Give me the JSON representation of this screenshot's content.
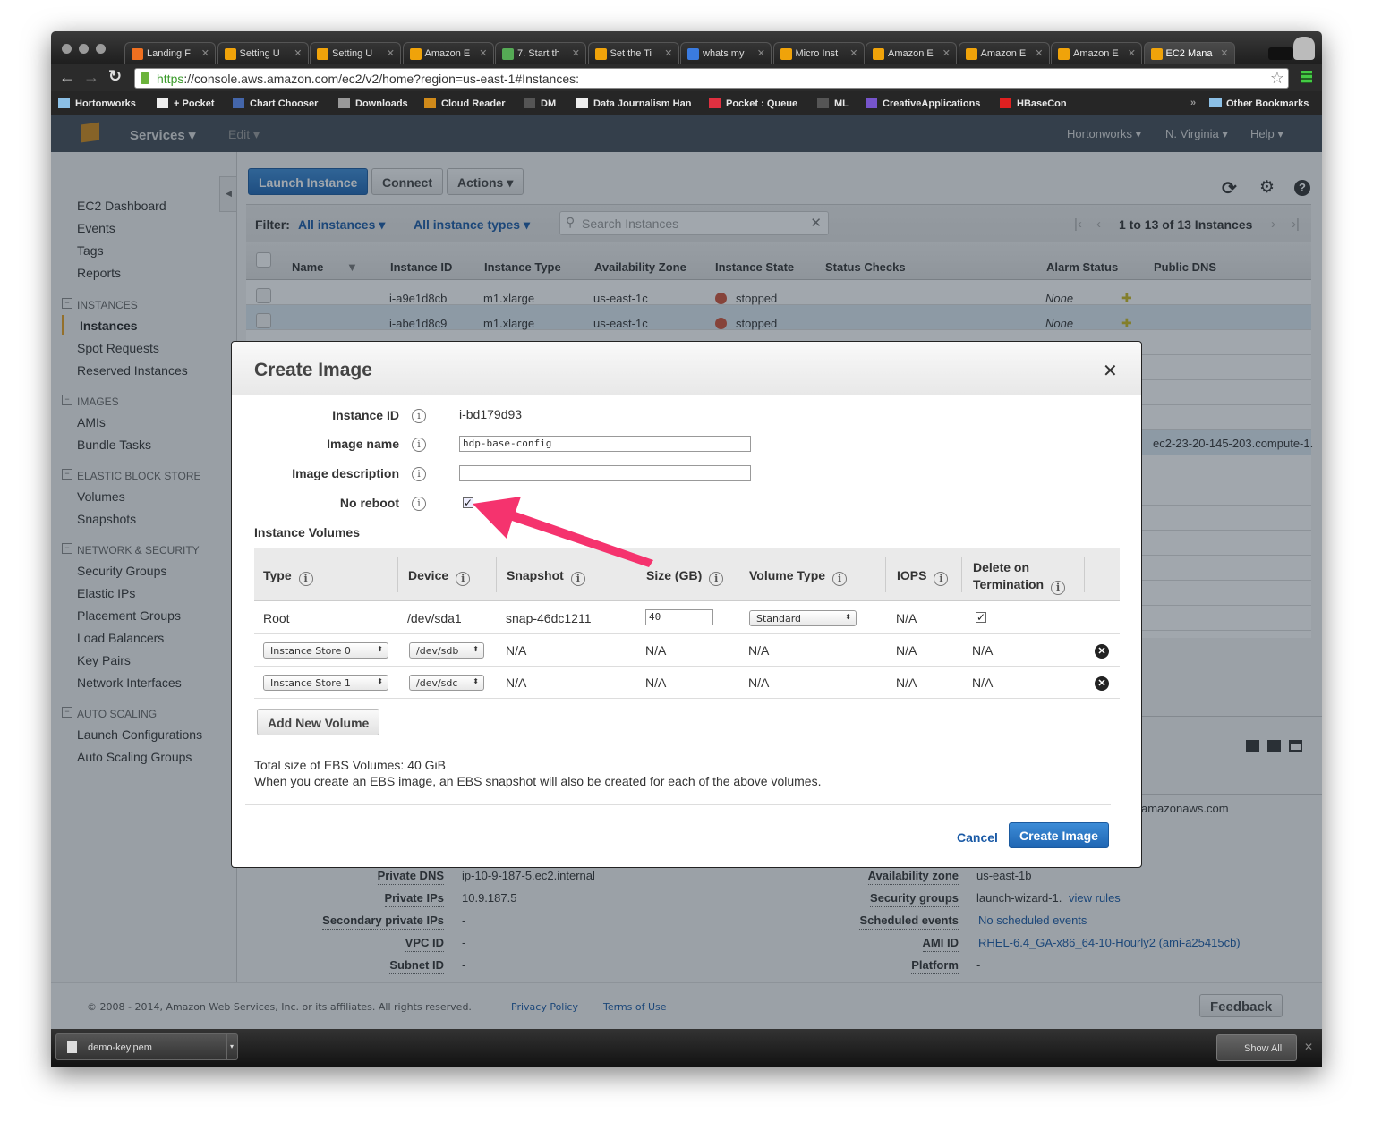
{
  "browser": {
    "tabs": [
      "Landing F",
      "Setting U",
      "Setting U",
      "Amazon E",
      "7. Start th",
      "Set the Ti",
      "whats my",
      "Micro Inst",
      "Amazon E",
      "Amazon E",
      "Amazon E",
      "EC2 Mana"
    ],
    "url_scheme": "https",
    "url_rest": "://console.aws.amazon.com/ec2/v2/home?region=us-east-1#Instances:",
    "bookmarks": [
      "Hortonworks",
      "+ Pocket",
      "Chart Chooser",
      "Downloads",
      "Cloud Reader",
      "DM",
      "Data Journalism Han",
      "Pocket : Queue",
      "ML",
      "CreativeApplications",
      "HBaseCon"
    ],
    "overflow": "»",
    "other_bookmarks": "Other Bookmarks"
  },
  "aws_nav": {
    "services": "Services",
    "edit": "Edit",
    "account": "Hortonworks",
    "region": "N. Virginia",
    "help": "Help"
  },
  "sidebar": {
    "top": [
      "EC2 Dashboard",
      "Events",
      "Tags",
      "Reports"
    ],
    "sections": [
      {
        "title": "INSTANCES",
        "items": [
          "Instances",
          "Spot Requests",
          "Reserved Instances"
        ]
      },
      {
        "title": "IMAGES",
        "items": [
          "AMIs",
          "Bundle Tasks"
        ]
      },
      {
        "title": "ELASTIC BLOCK STORE",
        "items": [
          "Volumes",
          "Snapshots"
        ]
      },
      {
        "title": "NETWORK & SECURITY",
        "items": [
          "Security Groups",
          "Elastic IPs",
          "Placement Groups",
          "Load Balancers",
          "Key Pairs",
          "Network Interfaces"
        ]
      },
      {
        "title": "AUTO SCALING",
        "items": [
          "Launch Configurations",
          "Auto Scaling Groups"
        ]
      }
    ]
  },
  "toolbar": {
    "launch": "Launch Instance",
    "connect": "Connect",
    "actions": "Actions"
  },
  "filter": {
    "label": "Filter:",
    "instances": "All instances",
    "types": "All instance types",
    "search_placeholder": "Search Instances",
    "pagination": "1 to 13 of 13 Instances"
  },
  "table": {
    "headers": [
      "Name",
      "Instance ID",
      "Instance Type",
      "Availability Zone",
      "Instance State",
      "Status Checks",
      "Alarm Status",
      "Public DNS"
    ],
    "rows": [
      {
        "id": "i-a9e1d8cb",
        "type": "m1.xlarge",
        "az": "us-east-1c",
        "state": "stopped",
        "alarm": "None"
      },
      {
        "id": "i-abe1d8c9",
        "type": "m1.xlarge",
        "az": "us-east-1c",
        "state": "stopped",
        "alarm": "None"
      }
    ],
    "dns_visible": "ec2-23-20-145-203.compute-1.",
    "dns_suffix": "amazonaws.com"
  },
  "details": {
    "left": [
      [
        "Private DNS",
        "ip-10-9-187-5.ec2.internal"
      ],
      [
        "Private IPs",
        "10.9.187.5"
      ],
      [
        "Secondary private IPs",
        "-"
      ],
      [
        "VPC ID",
        "-"
      ],
      [
        "Subnet ID",
        "-"
      ]
    ],
    "right": [
      [
        "Availability zone",
        "us-east-1b"
      ],
      [
        "Security groups",
        "launch-wizard-1. "
      ],
      [
        "Scheduled events",
        "No scheduled events"
      ],
      [
        "AMI ID",
        "RHEL-6.4_GA-x86_64-10-Hourly2 (ami-a25415cb)"
      ],
      [
        "Platform",
        "-"
      ]
    ],
    "view_rules": "view rules"
  },
  "footer": {
    "copyright": "© 2008 - 2014, Amazon Web Services, Inc. or its affiliates. All rights reserved.",
    "privacy": "Privacy Policy",
    "terms": "Terms of Use",
    "feedback": "Feedback"
  },
  "downloads": {
    "file": "demo-key.pem",
    "show_all": "Show All"
  },
  "modal": {
    "title": "Create Image",
    "instance_id_label": "Instance ID",
    "instance_id": "i-bd179d93",
    "image_name_label": "Image name",
    "image_name": "hdp-base-config",
    "image_desc_label": "Image description",
    "image_desc": "",
    "no_reboot_label": "No reboot",
    "no_reboot": true,
    "volumes_title": "Instance Volumes",
    "vol_headers": [
      "Type",
      "Device",
      "Snapshot",
      "Size (GB)",
      "Volume Type",
      "IOPS",
      "Delete on",
      "Termination"
    ],
    "volumes": [
      {
        "type": "Root",
        "device": "/dev/sda1",
        "snapshot": "snap-46dc1211",
        "size": "40",
        "vtype": "Standard",
        "iops": "N/A",
        "delete": true
      },
      {
        "type": "Instance Store 0",
        "device": "/dev/sdb",
        "snapshot": "N/A",
        "size": "N/A",
        "vtype": "N/A",
        "iops": "N/A",
        "delete": "N/A"
      },
      {
        "type": "Instance Store 1",
        "device": "/dev/sdc",
        "snapshot": "N/A",
        "size": "N/A",
        "vtype": "N/A",
        "iops": "N/A",
        "delete": "N/A"
      }
    ],
    "add_volume": "Add New Volume",
    "total": "Total size of EBS Volumes: 40 GiB",
    "note": "When you create an EBS image, an EBS snapshot will also be created for each of the above volumes.",
    "cancel": "Cancel",
    "create": "Create Image"
  },
  "colors": {
    "accent": "#1f66b3",
    "arrow": "#f5336e"
  }
}
